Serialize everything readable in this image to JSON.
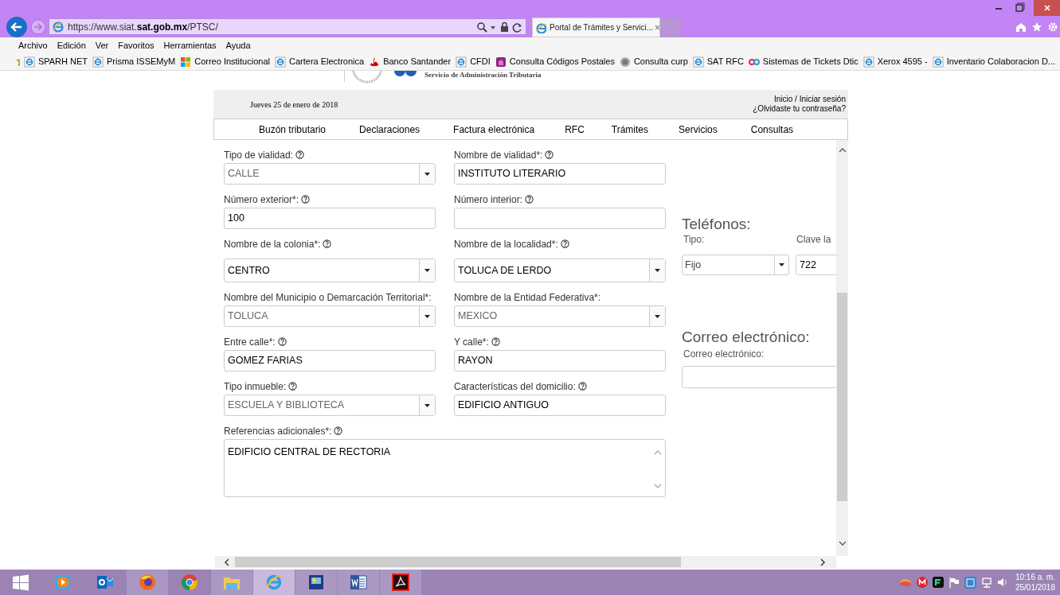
{
  "browser": {
    "url_prefix": "https://www.siat.",
    "url_domain": "sat.gob.mx",
    "url_path": "/PTSC/",
    "tab_title": "Portal de Trámites y Servici...",
    "tab_close": "×"
  },
  "menu": [
    "Archivo",
    "Edición",
    "Ver",
    "Favoritos",
    "Herramientas",
    "Ayuda"
  ],
  "favorites": [
    {
      "label": "SPARH NET",
      "kind": "ie"
    },
    {
      "label": "Prisma ISSEMyM",
      "kind": "ie"
    },
    {
      "label": "Correo Institucional",
      "kind": "tiles"
    },
    {
      "label": "Cartera Electronica",
      "kind": "ie"
    },
    {
      "label": "Banco Santander",
      "kind": "flame"
    },
    {
      "label": "CFDI",
      "kind": "ie"
    },
    {
      "label": "Consulta Códigos Postales",
      "kind": "hand"
    },
    {
      "label": "Consulta curp",
      "kind": "seal"
    },
    {
      "label": "SAT RFC",
      "kind": "ie"
    },
    {
      "label": "Sistemas de Tickets Dtic",
      "kind": "loop"
    },
    {
      "label": "Xerox 4595 -",
      "kind": "ie"
    },
    {
      "label": "Inventario Colaboracion D...",
      "kind": "ie"
    }
  ],
  "header": {
    "agency": "Servicio de Administración Tributaria",
    "date": "Jueves 25 de enero de 2018",
    "login": "Inicio / Iniciar sesión",
    "forgot": "¿Olvidaste tu contraseña?"
  },
  "nav": [
    "Buzón tributario",
    "Declaraciones",
    "Factura electrónica",
    "RFC",
    "Trámites",
    "Servicios",
    "Consultas"
  ],
  "form_rows": [
    [
      {
        "label": "Tipo de vialidad:",
        "help": true,
        "kind": "select",
        "value": "CALLE",
        "disabled": true
      },
      {
        "label": "Nombre de vialidad*:",
        "help": true,
        "kind": "text",
        "value": "INSTITUTO LITERARIO"
      }
    ],
    [
      {
        "label": "Número exterior*:",
        "help": true,
        "kind": "text",
        "value": "100"
      },
      {
        "label": "Número interior:",
        "help": true,
        "kind": "text"
      }
    ],
    [
      {
        "label": "Nombre de la colonia*:",
        "help": true,
        "kind": "select",
        "value": "CENTRO",
        "disabled": false
      },
      {
        "label": "Nombre de la localidad*:",
        "help": true,
        "kind": "select",
        "value": "TOLUCA DE LERDO",
        "disabled": false
      }
    ],
    [
      {
        "label": "Nombre del Municipio o Demarcación Territorial*:",
        "help": false,
        "kind": "select",
        "value": "TOLUCA",
        "disabled": true
      },
      {
        "label": "Nombre de la Entidad Federativa*:",
        "help": false,
        "kind": "select",
        "value": "MEXICO",
        "disabled": true
      }
    ],
    [
      {
        "label": "Entre calle*:",
        "help": true,
        "kind": "text",
        "value": "GOMEZ FARIAS"
      },
      {
        "label": "Y calle*:",
        "help": true,
        "kind": "text",
        "value": "RAYON"
      }
    ],
    [
      {
        "label": "Tipo inmueble:",
        "help": true,
        "kind": "select",
        "value": "ESCUELA Y BIBLIOTECA",
        "disabled": true
      },
      {
        "label": "Características del domicilio:",
        "help": true,
        "kind": "text",
        "value": "EDIFICIO ANTIGUO"
      }
    ],
    [
      {
        "label": "Referencias adicionales*:",
        "help": true,
        "kind": "textarea",
        "value": "EDIFICIO CENTRAL DE RECTORIA"
      }
    ]
  ],
  "phones": {
    "heading": "Teléfonos:",
    "type_label": "Tipo:",
    "code_label": "Clave la",
    "type_value": "Fijo",
    "code_value": "722"
  },
  "email": {
    "heading": "Correo electrónico:",
    "label": "Correo electrónico:"
  },
  "taskbar": [
    {
      "kind": "start",
      "open": false,
      "selected": false
    },
    {
      "kind": "media",
      "open": false,
      "selected": false
    },
    {
      "kind": "outlook",
      "open": false,
      "selected": false
    },
    {
      "kind": "firefox",
      "open": true,
      "selected": false
    },
    {
      "kind": "chrome",
      "open": false,
      "selected": false
    },
    {
      "kind": "folder",
      "open": true,
      "selected": false
    },
    {
      "kind": "ie",
      "open": true,
      "selected": true
    },
    {
      "kind": "app",
      "open": true,
      "selected": false
    },
    {
      "kind": "word",
      "open": true,
      "selected": false
    },
    {
      "kind": "acrobat",
      "open": true,
      "selected": false
    }
  ],
  "clock": {
    "time": "10:16 a. m.",
    "date": "25/01/2018"
  }
}
